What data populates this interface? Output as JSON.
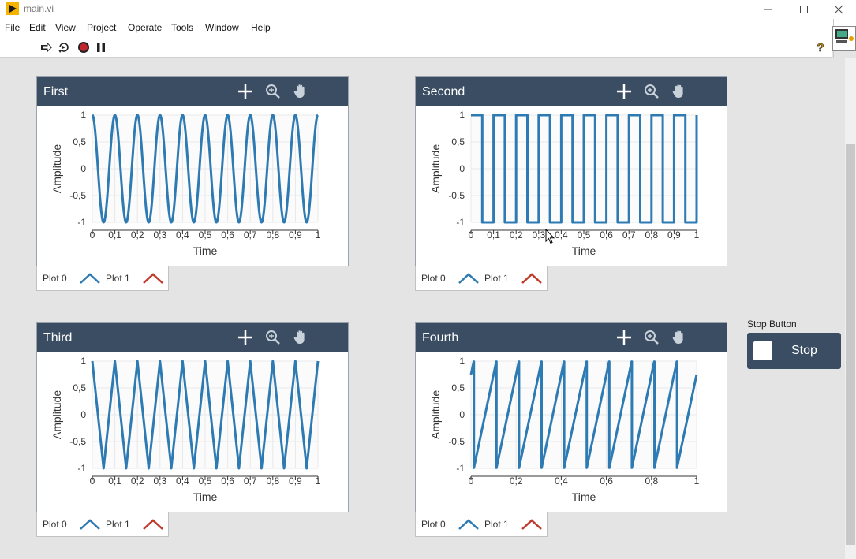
{
  "window": {
    "title": "main.vi",
    "minimize_icon": "minimize-icon",
    "maximize_icon": "maximize-icon",
    "close_icon": "close-icon"
  },
  "menu": [
    "File",
    "Edit",
    "View",
    "Project",
    "Operate",
    "Tools",
    "Window",
    "Help"
  ],
  "toolbar": {
    "icons": [
      "run-arrow-icon",
      "run-continuously-icon",
      "abort-icon",
      "pause-icon"
    ],
    "help_icon": "context-help-icon"
  },
  "graph_tools": [
    "cursor-crosshair-icon",
    "zoom-icon",
    "pan-hand-icon"
  ],
  "legend": {
    "plot0": "Plot 0",
    "plot1": "Plot 1",
    "plot0_color": "#2e7bb4",
    "plot1_color": "#c0392b"
  },
  "colors": {
    "header": "#3a4d63",
    "trace": "#2e7bb4",
    "stop_button": "#3a4d63"
  },
  "graphs": [
    {
      "title": "First",
      "xlabel": "Time",
      "ylabel": "Amplitude",
      "xticks": [
        "0",
        "0,1",
        "0,2",
        "0,3",
        "0,4",
        "0,5",
        "0,6",
        "0,7",
        "0,8",
        "0,9",
        "1"
      ],
      "yticks": [
        "1",
        "0,5",
        "0",
        "-0,5",
        "-1"
      ]
    },
    {
      "title": "Second",
      "xlabel": "Time",
      "ylabel": "Amplitude",
      "xticks": [
        "0",
        "0,1",
        "0,2",
        "0,3",
        "0,4",
        "0,5",
        "0,6",
        "0,7",
        "0,8",
        "0,9",
        "1"
      ],
      "yticks": [
        "1",
        "0,5",
        "0",
        "-0,5",
        "-1"
      ]
    },
    {
      "title": "Third",
      "xlabel": "Time",
      "ylabel": "Amplitude",
      "xticks": [
        "0",
        "0,1",
        "0,2",
        "0,3",
        "0,4",
        "0,5",
        "0,6",
        "0,7",
        "0,8",
        "0,9",
        "1"
      ],
      "yticks": [
        "1",
        "0,5",
        "0",
        "-0,5",
        "-1"
      ]
    },
    {
      "title": "Fourth",
      "xlabel": "Time",
      "ylabel": "Amplitude",
      "xticks": [
        "0",
        "0,2",
        "0,4",
        "0,6",
        "0,8",
        "1"
      ],
      "yticks": [
        "1",
        "0,5",
        "0",
        "-0,5",
        "-1"
      ]
    }
  ],
  "chart_data": [
    {
      "type": "line",
      "title": "First",
      "xlabel": "Time",
      "ylabel": "Amplitude",
      "xlim": [
        0,
        1
      ],
      "ylim": [
        -1,
        1
      ],
      "waveform": "sine",
      "cycles": 10,
      "phase_deg": 90,
      "grid": true,
      "series": [
        {
          "name": "Plot 0"
        }
      ]
    },
    {
      "type": "line",
      "title": "Second",
      "xlabel": "Time",
      "ylabel": "Amplitude",
      "xlim": [
        0,
        1
      ],
      "ylim": [
        -1,
        1
      ],
      "waveform": "square",
      "cycles": 10,
      "grid": true,
      "series": [
        {
          "name": "Plot 0"
        }
      ]
    },
    {
      "type": "line",
      "title": "Third",
      "xlabel": "Time",
      "ylabel": "Amplitude",
      "xlim": [
        0,
        1
      ],
      "ylim": [
        -1,
        1
      ],
      "waveform": "triangle",
      "cycles": 10,
      "phase_deg": 90,
      "grid": true,
      "series": [
        {
          "name": "Plot 0"
        }
      ]
    },
    {
      "type": "line",
      "title": "Fourth",
      "xlabel": "Time",
      "ylabel": "Amplitude",
      "xlim": [
        0,
        1
      ],
      "ylim": [
        -1,
        1
      ],
      "waveform": "sawtooth",
      "cycles": 10,
      "phase_deg": 135,
      "grid": true,
      "series": [
        {
          "name": "Plot 0"
        }
      ]
    }
  ],
  "stop": {
    "label": "Stop Button",
    "text": "Stop"
  }
}
